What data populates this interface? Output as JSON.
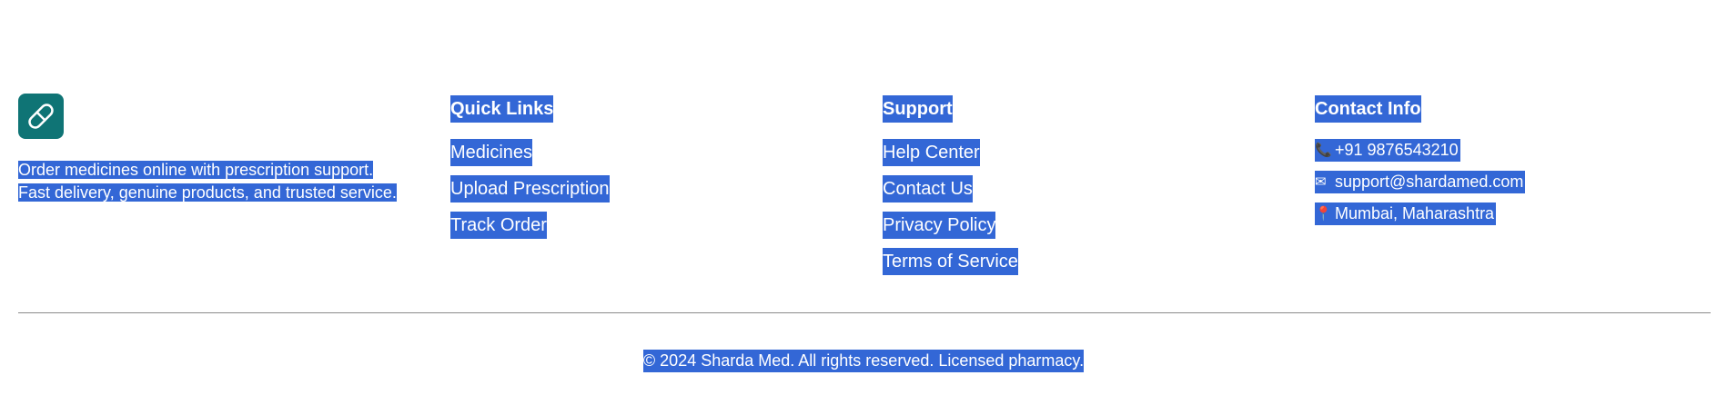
{
  "brand": {
    "logo_icon": "pill-icon",
    "logo_color": "#0f7475",
    "description": "Order medicines online with prescription support. Fast delivery, genuine products, and trusted service."
  },
  "quick_links": {
    "heading": "Quick Links",
    "items": [
      {
        "label": "Medicines"
      },
      {
        "label": "Upload Prescription"
      },
      {
        "label": "Track Order"
      }
    ]
  },
  "support": {
    "heading": "Support",
    "items": [
      {
        "label": "Help Center"
      },
      {
        "label": "Contact Us"
      },
      {
        "label": "Privacy Policy"
      },
      {
        "label": "Terms of Service"
      }
    ]
  },
  "contact": {
    "heading": "Contact Info",
    "items": [
      {
        "icon": "phone-icon",
        "glyph": "📞",
        "text": "+91 9876543210"
      },
      {
        "icon": "email-icon",
        "glyph": "✉",
        "text": "support@shardamed.com"
      },
      {
        "icon": "location-pin-icon",
        "glyph": "📍",
        "text": "Mumbai, Maharashtra"
      }
    ]
  },
  "footer": {
    "copyright": "© 2024 Sharda Med. All rights reserved. Licensed pharmacy."
  },
  "colors": {
    "selection": "#3367d6",
    "divider": "#8a8a8a"
  }
}
